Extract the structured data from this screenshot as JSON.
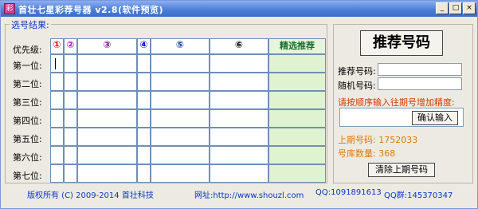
{
  "window": {
    "title": "首壮七星彩荐号器 v2.8(软件预览)",
    "icon": "app-icon",
    "controls": [
      "_",
      "□",
      "×"
    ]
  },
  "grid": {
    "group_title": "选号结果:",
    "priority_label": "优先级:",
    "columns": [
      {
        "label": "①",
        "color": "#e00000"
      },
      {
        "label": "②",
        "color": "#d000d0"
      },
      {
        "label": "③",
        "color": "#7a0b86"
      },
      {
        "label": "④",
        "color": "#0000d0"
      },
      {
        "label": "⑤",
        "color": "#0a37a0"
      },
      {
        "label": "⑥",
        "color": "#000000"
      }
    ],
    "recommend_header": "精选推荐",
    "rows": [
      "第一位:",
      "第二位:",
      "第三位:",
      "第四位:",
      "第五位:",
      "第六位:",
      "第七位:"
    ]
  },
  "panel": {
    "recommend_button": "推荐号码",
    "recommend_label": "推荐号码:",
    "recommend_value": "",
    "random_label": "随机号码:",
    "random_value": "",
    "instruction": "请按顺序输入往期号增加精度:",
    "confirm_button": "确认输入",
    "last_draw": "上期号码: 1752033",
    "pool_count": "号库数量: 368",
    "clear_button": "清除上期号码"
  },
  "footer": {
    "copyright": "版权所有 (C) 2009-2014 首壮科技",
    "website": "网址:http://www.shouzl.com",
    "qq": "QQ:1091891613",
    "qq_group": "QQ群:145370347"
  },
  "colors": {
    "accent_blue": "#0a37c8",
    "instruction_red": "#d23c00",
    "info_orange": "#e07a00",
    "recommend_green": "#1a6f2f"
  }
}
